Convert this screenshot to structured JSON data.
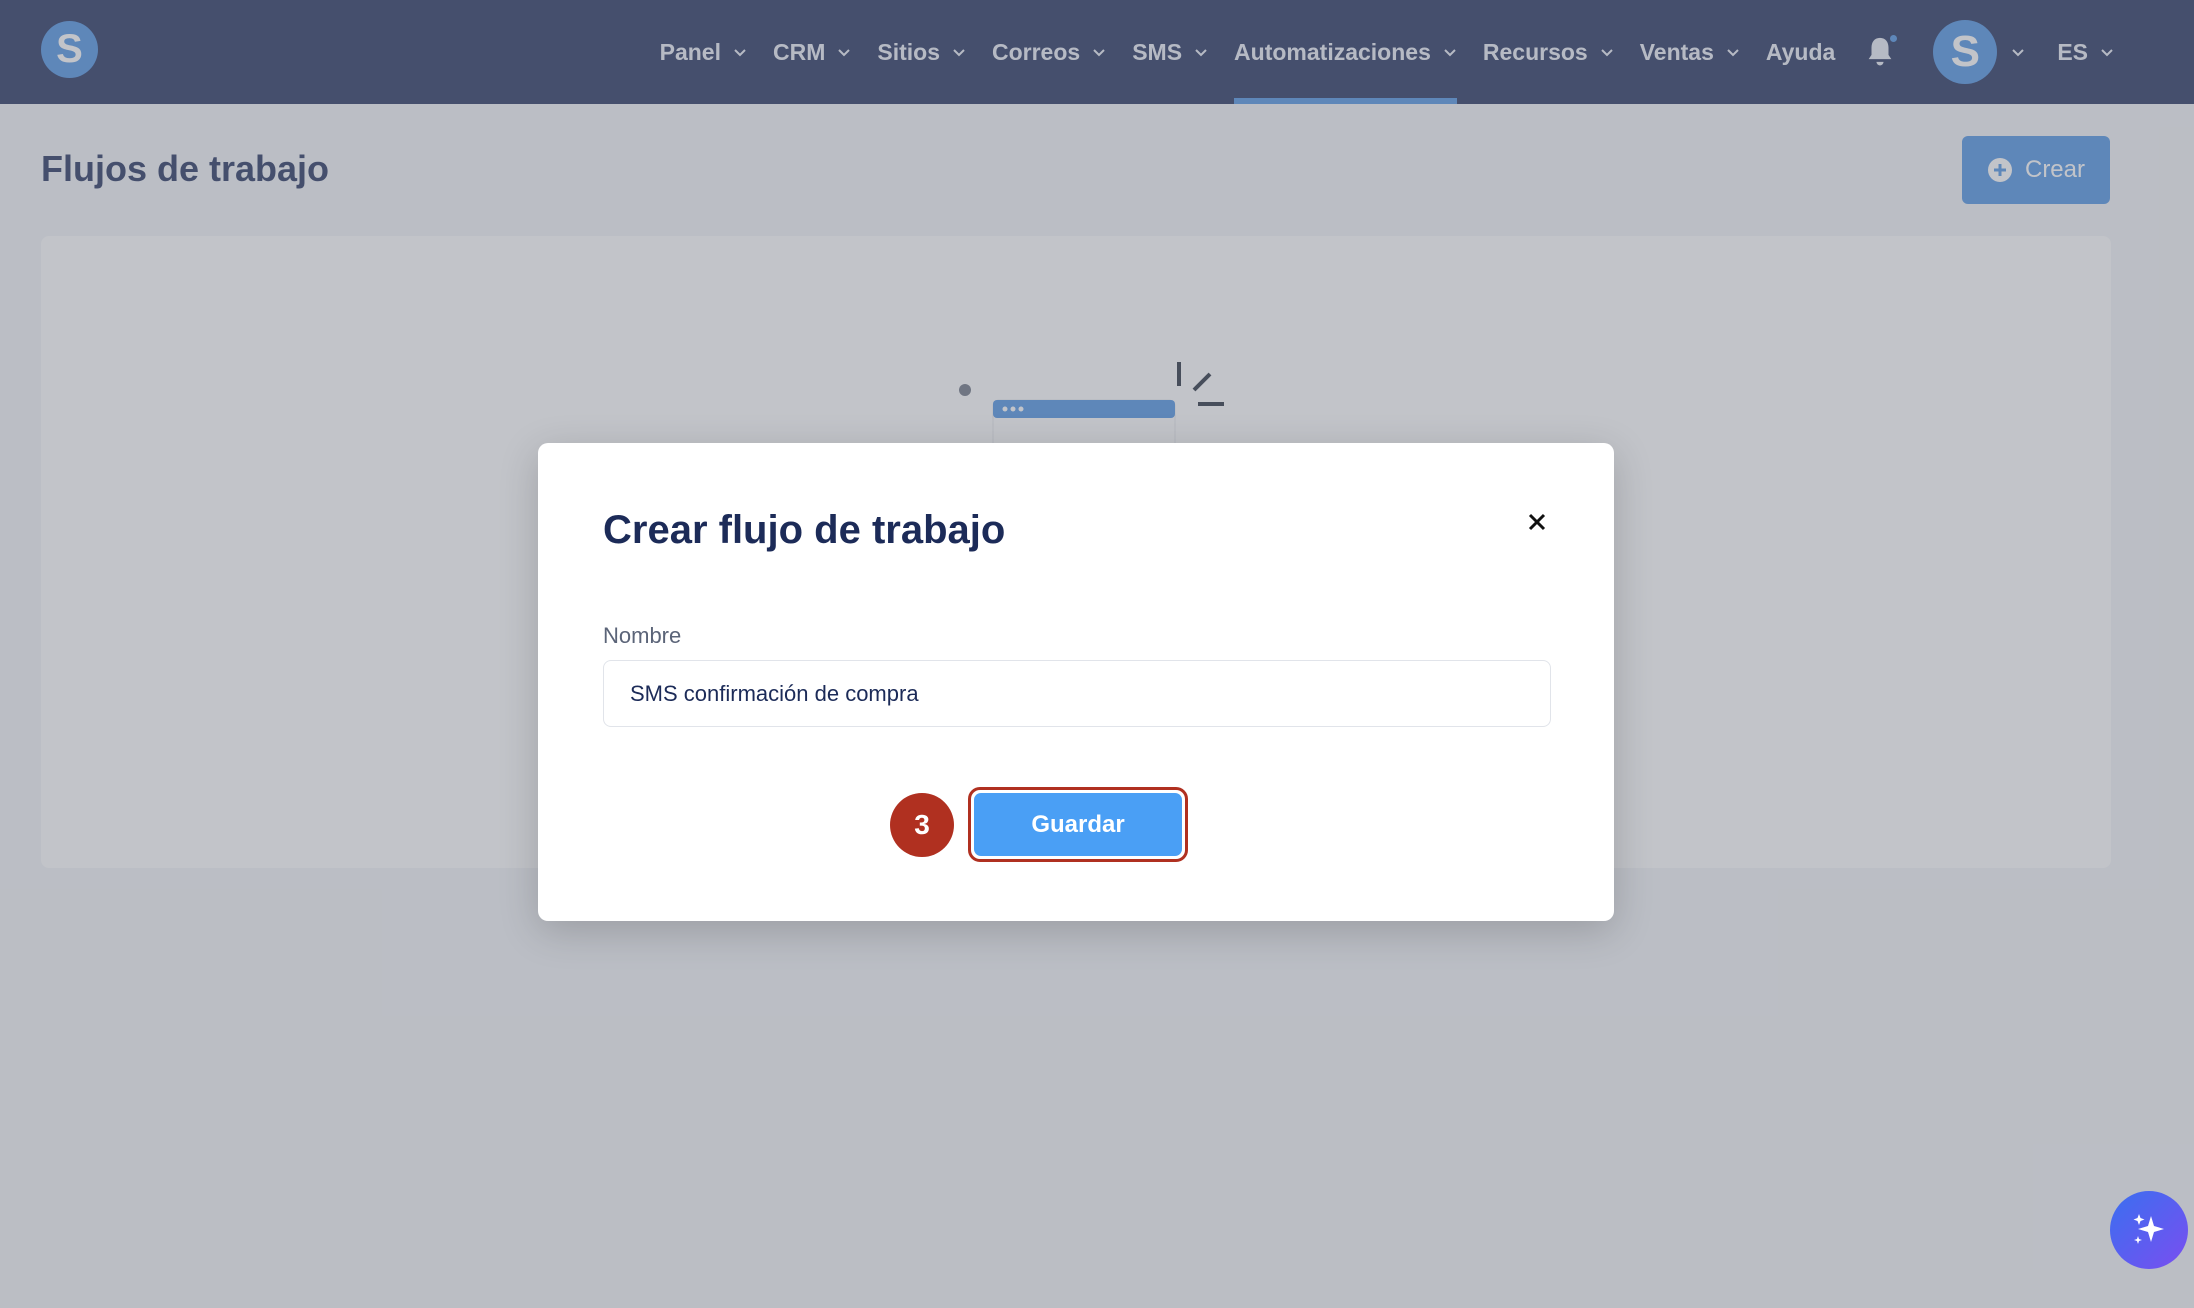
{
  "header": {
    "logo_letter": "S",
    "nav": [
      {
        "label": "Panel"
      },
      {
        "label": "CRM"
      },
      {
        "label": "Sitios"
      },
      {
        "label": "Correos"
      },
      {
        "label": "SMS"
      },
      {
        "label": "Automatizaciones",
        "active": true
      },
      {
        "label": "Recursos"
      },
      {
        "label": "Ventas"
      },
      {
        "label": "Ayuda"
      }
    ],
    "avatar_letter": "S",
    "language": "ES"
  },
  "page": {
    "title": "Flujos de trabajo",
    "create_label": "Crear"
  },
  "modal": {
    "title": "Crear flujo de trabajo",
    "name_label": "Nombre",
    "name_value": "SMS confirmación de compra",
    "step_number": "3",
    "save_label": "Guardar"
  },
  "colors": {
    "navbar": "#1c2b58",
    "accent": "#4a90e2",
    "highlight": "#b03020"
  },
  "icons": {
    "close": "close-icon",
    "bell": "bell-icon",
    "plus": "plus-circle-icon",
    "ai": "sparkle-icon"
  }
}
